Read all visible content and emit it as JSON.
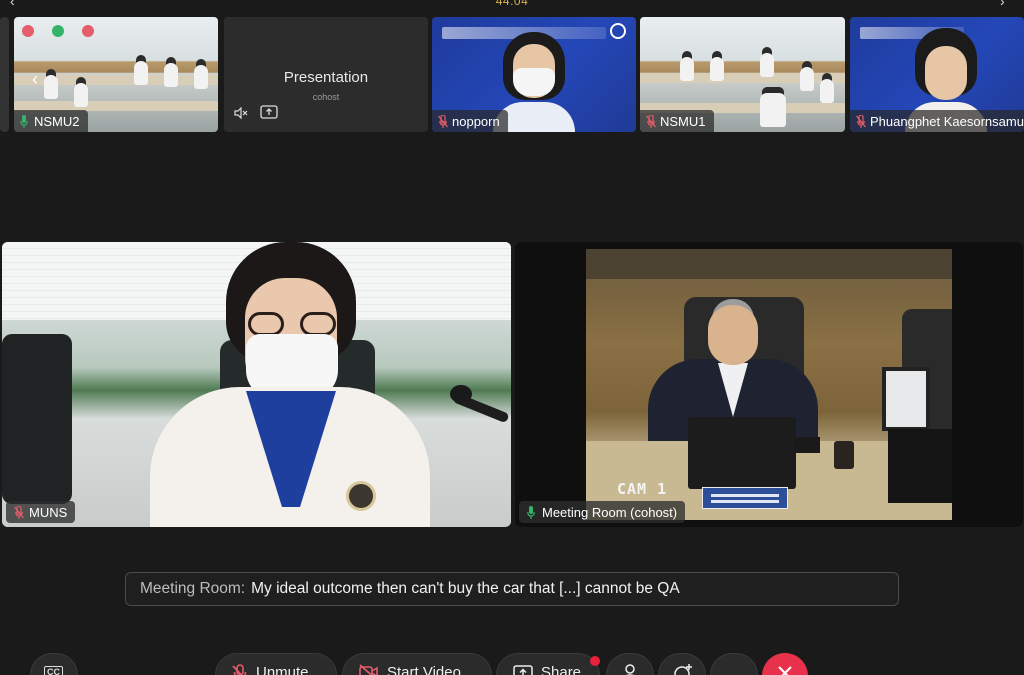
{
  "meeting": {
    "timer": "44:04"
  },
  "thumbnails": [
    {
      "name": "NSMU2",
      "muted": false
    },
    {
      "title": "Presentation",
      "subtitle": "cohost"
    },
    {
      "name": "nopporn",
      "muted": true
    },
    {
      "name": "NSMU1",
      "muted": true
    },
    {
      "name": "Phuangphet Kaesornsamut",
      "muted": true
    }
  ],
  "main_tiles": [
    {
      "name": "MUNS",
      "muted": true
    },
    {
      "name": "Meeting Room (cohost)",
      "muted": false,
      "overlay_text": "CAM 1"
    }
  ],
  "caption": {
    "speaker": "Meeting Room:",
    "text": "My ideal outcome then can't buy the car that [...] cannot be QA"
  },
  "toolbar": {
    "unmute_label": "Unmute",
    "start_video_label": "Start Video",
    "share_label": "Share"
  },
  "icons": {
    "mic_on": "mic-icon",
    "mic_off": "mic-off-icon",
    "speaker_muted": "speaker-muted-icon",
    "share": "share-screen-icon",
    "participants": "participants-icon",
    "reactions": "reaction-icon",
    "more": "more-icon",
    "end": "end-call-icon",
    "captions": "captions-icon"
  },
  "colors": {
    "timer": "#d8b04c",
    "mic_on": "#35b36b",
    "mic_off": "#e35d6a",
    "end_call": "#e8314a"
  }
}
